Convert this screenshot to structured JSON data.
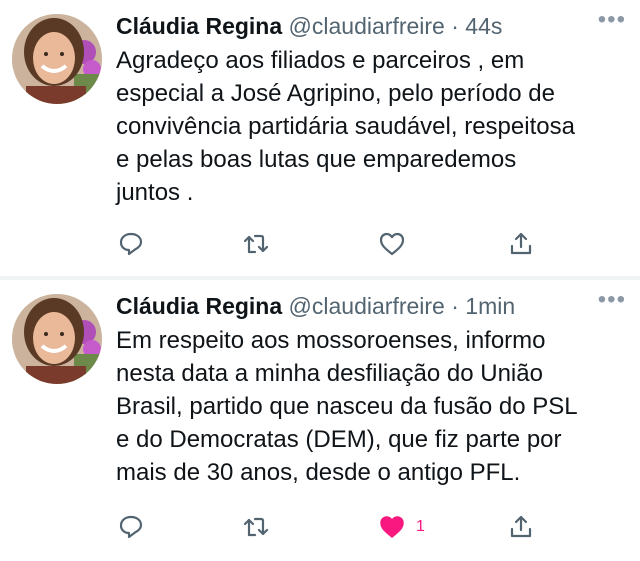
{
  "tweets": [
    {
      "author_name": "Cláudia Regina",
      "handle": "@claudiarfreire",
      "separator": "·",
      "time": "44s",
      "more": "•••",
      "text": "Agradeço aos filiados e parceiros , em\nespecial a José Agripino, pelo período de\nconvivência partidária saudável, respeitosa\ne pelas boas lutas que emparedemos\njuntos .",
      "liked": false,
      "like_count": "",
      "icons": [
        "reply-icon",
        "retweet-icon",
        "like-icon",
        "share-icon"
      ]
    },
    {
      "author_name": "Cláudia Regina",
      "handle": "@claudiarfreire",
      "separator": "·",
      "time": "1min",
      "more": "•••",
      "text": "Em respeito aos mossoroenses, informo\nnesta data a minha desfiliação do União\nBrasil, partido que nasceu da fusão do PSL\ne do Democratas (DEM), que fiz parte por\nmais de 30 anos, desde o antigo PFL.",
      "liked": true,
      "like_count": "1",
      "icons": [
        "reply-icon",
        "retweet-icon",
        "like-icon-filled",
        "share-icon"
      ]
    }
  ],
  "colors": {
    "text": "#0f1419",
    "muted": "#536471",
    "like_active": "#f91880",
    "divider": "#eff3f4"
  }
}
